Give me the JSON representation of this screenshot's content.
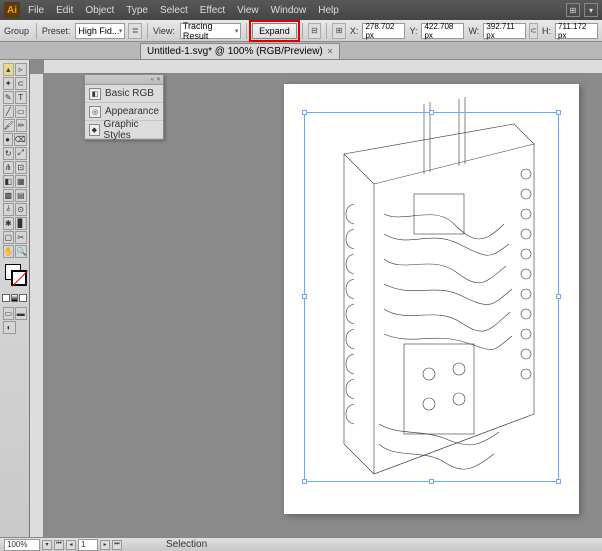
{
  "menu": {
    "items": [
      "File",
      "Edit",
      "Object",
      "Type",
      "Select",
      "Effect",
      "View",
      "Window",
      "Help"
    ]
  },
  "controlbar": {
    "group_label": "Group",
    "preset_label": "Preset:",
    "preset_value": "High Fid...",
    "view_label": "View:",
    "view_value": "Tracing Result",
    "expand_label": "Expand",
    "x_label": "X:",
    "y_label": "Y:",
    "w_label": "W:",
    "h_label": "H:",
    "x_value": "278.702 px",
    "y_value": "422.708 px",
    "w_value": "392.711 px",
    "h_value": "711.172 px"
  },
  "tab": {
    "title": "Untitled-1.svg* @ 100% (RGB/Preview)"
  },
  "panel": {
    "rows": [
      {
        "icon": "◧",
        "label": "Basic RGB"
      },
      {
        "icon": "◎",
        "label": "Appearance"
      },
      {
        "icon": "◆",
        "label": "Graphic Styles"
      }
    ]
  },
  "status": {
    "zoom": "100%",
    "mode": "Selection"
  }
}
